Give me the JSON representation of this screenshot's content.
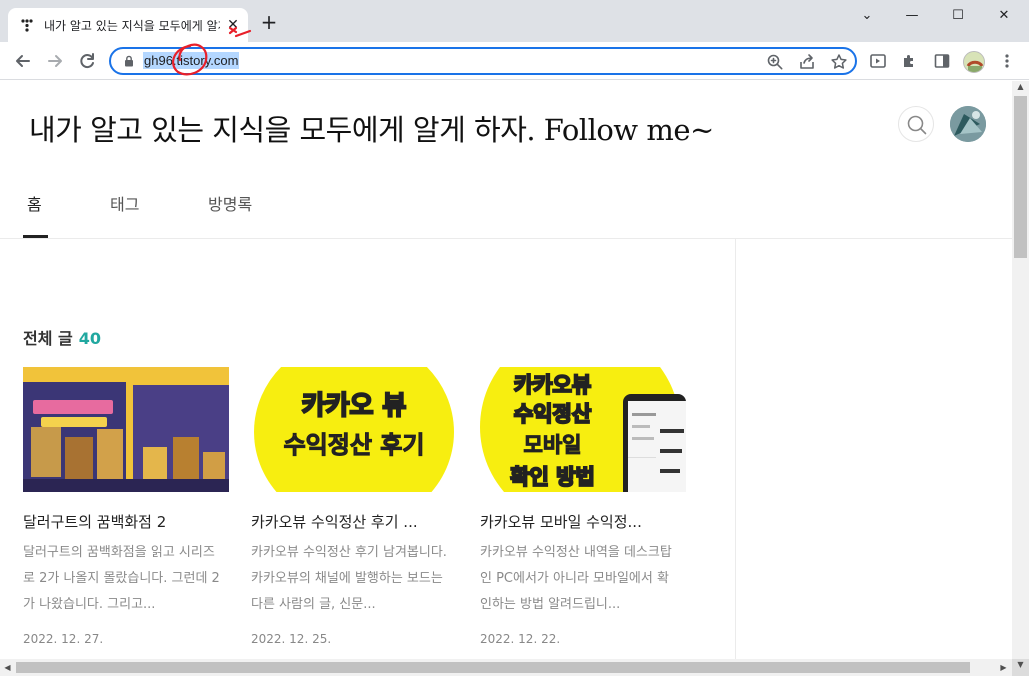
{
  "browser": {
    "tab_title": "내가 알고 있는 지식을 모두에게 알게 하자. Follow me~",
    "tab_close": "✕",
    "new_tab": "+",
    "url": "gh96.tistory.com",
    "controls": {
      "minimize": "—",
      "maximize": "☐",
      "close": "✕",
      "dropdown": "⌄"
    }
  },
  "blog": {
    "title": "내가 알고 있는 지식을 모두에게 알게 하자. Follow me~",
    "nav": [
      {
        "label": "홈"
      },
      {
        "label": "태그"
      },
      {
        "label": "방명록"
      }
    ],
    "section_label": "전체 글",
    "post_count": "40",
    "posts": [
      {
        "title": "달러구트의 꿈백화점 2",
        "excerpt": "달러구트의 꿈백화점을 읽고 시리즈로 2가 나올지 몰랐습니다. 그런데 2가 나왔습니다. 그리고...",
        "date": "2022. 12. 27."
      },
      {
        "title": "카카오뷰 수익정산 후기 ...",
        "excerpt": "카카오뷰 수익정산 후기 남겨봅니다. 카카오뷰의 채널에 발행하는 보드는 다른 사람의 글, 신문...",
        "date": "2022. 12. 25.",
        "thumb_text": [
          "카카오 뷰",
          "수익정산 후기"
        ]
      },
      {
        "title": "카카오뷰 모바일 수익정...",
        "excerpt": "카카오뷰 수익정산 내역을 데스크탑인 PC에서가 아니라 모바일에서 확인하는 방법 알려드립니...",
        "date": "2022. 12. 22.",
        "thumb_text": [
          "카카오뷰",
          "수익정산",
          "모바일",
          "확인 방법"
        ]
      }
    ]
  },
  "colors": {
    "accent": "#21a8a0",
    "thumb_yellow": "#f7ee10",
    "thumb_red": "#e8352b",
    "omnibox_border": "#1a73e8"
  }
}
